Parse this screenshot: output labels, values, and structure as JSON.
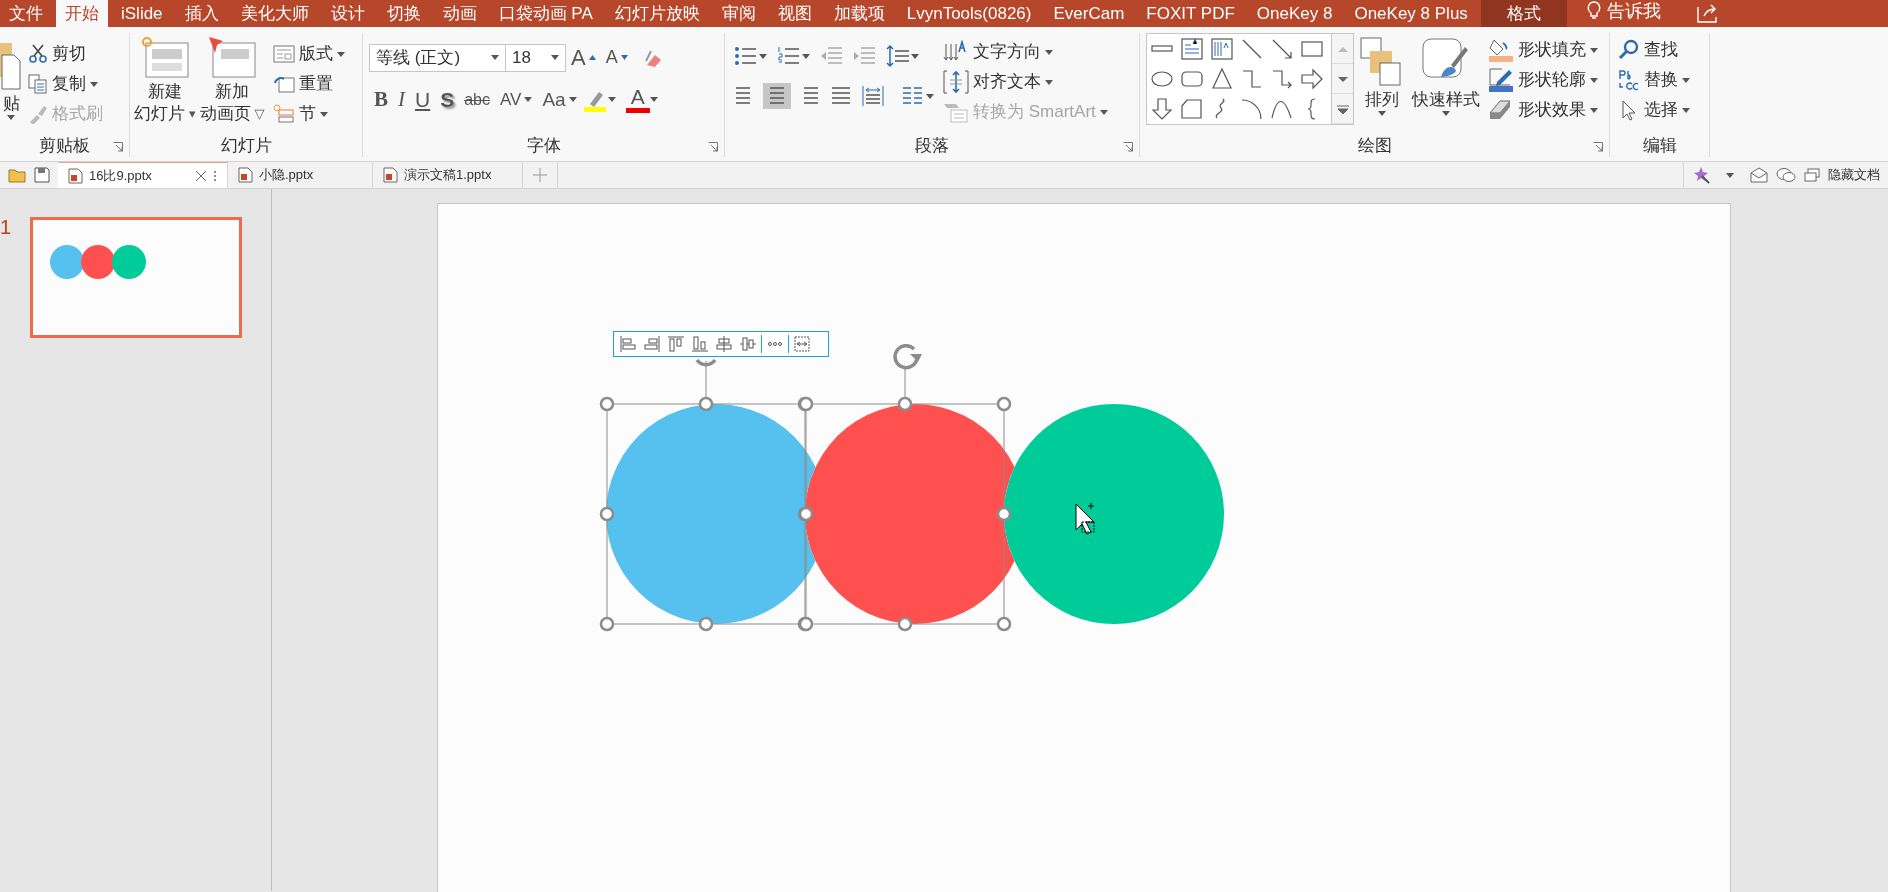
{
  "menu_tabs": [
    {
      "label": "文件",
      "selected": false,
      "contextual": false
    },
    {
      "label": "开始",
      "selected": true,
      "contextual": false
    },
    {
      "label": "iSlide",
      "selected": false,
      "contextual": false
    },
    {
      "label": "插入",
      "selected": false,
      "contextual": false
    },
    {
      "label": "美化大师",
      "selected": false,
      "contextual": false
    },
    {
      "label": "设计",
      "selected": false,
      "contextual": false
    },
    {
      "label": "切换",
      "selected": false,
      "contextual": false
    },
    {
      "label": "动画",
      "selected": false,
      "contextual": false
    },
    {
      "label": "口袋动画 PA",
      "selected": false,
      "contextual": false
    },
    {
      "label": "幻灯片放映",
      "selected": false,
      "contextual": false
    },
    {
      "label": "审阅",
      "selected": false,
      "contextual": false
    },
    {
      "label": "视图",
      "selected": false,
      "contextual": false
    },
    {
      "label": "加载项",
      "selected": false,
      "contextual": false
    },
    {
      "label": "LvynTools(0826)",
      "selected": false,
      "contextual": false
    },
    {
      "label": "EverCam",
      "selected": false,
      "contextual": false
    },
    {
      "label": "FOXIT PDF",
      "selected": false,
      "contextual": false
    },
    {
      "label": "OneKey 8",
      "selected": false,
      "contextual": false
    },
    {
      "label": "OneKey 8 Plus",
      "selected": false,
      "contextual": false
    },
    {
      "label": "格式",
      "selected": false,
      "contextual": true
    }
  ],
  "tell_me": "告诉我",
  "clipboard": {
    "title": "剪贴板",
    "paste": "贴",
    "items": [
      {
        "label": "剪切",
        "disabled": false,
        "dropdown": false
      },
      {
        "label": "复制",
        "disabled": false,
        "dropdown": true
      },
      {
        "label": "格式刷",
        "disabled": true,
        "dropdown": false
      }
    ]
  },
  "slides": {
    "title": "幻灯片",
    "big_buttons": [
      {
        "lines": [
          "新建",
          "幻灯片"
        ],
        "glyph": "▾"
      },
      {
        "lines": [
          "新加",
          "动画页"
        ],
        "glyph": "▽"
      }
    ],
    "small_buttons": [
      {
        "label": "版式",
        "dropdown": true
      },
      {
        "label": "重置",
        "dropdown": false
      },
      {
        "label": "节",
        "dropdown": true
      }
    ]
  },
  "font": {
    "title": "字体",
    "font_name": "等线 (正文)",
    "font_size": "18",
    "size_buttons": [
      {
        "label": "A",
        "kind": "grow"
      },
      {
        "label": "A",
        "kind": "shrink"
      }
    ],
    "format_buttons": [
      {
        "label": "B",
        "kind": "bold"
      },
      {
        "label": "I",
        "kind": "italic"
      },
      {
        "label": "U",
        "kind": "underline"
      },
      {
        "label": "S",
        "kind": "shadow"
      },
      {
        "label": "abc",
        "kind": "strike"
      },
      {
        "label": "AV",
        "kind": "spacing"
      },
      {
        "label": "Aa",
        "kind": "case"
      },
      {
        "label": "A",
        "kind": "color"
      }
    ]
  },
  "paragraph": {
    "title": "段落",
    "align": [
      {
        "selected": false
      },
      {
        "selected": true
      },
      {
        "selected": false
      },
      {
        "selected": false
      },
      {
        "selected": false
      }
    ],
    "commands": [
      {
        "label": "文字方向",
        "disabled": false
      },
      {
        "label": "对齐文本",
        "disabled": false
      },
      {
        "label": "转换为 SmartArt",
        "disabled": true
      }
    ]
  },
  "drawing": {
    "title": "绘图",
    "arrange": "排列",
    "quick_styles": "快速样式",
    "commands": [
      {
        "label": "形状填充"
      },
      {
        "label": "形状轮廓"
      },
      {
        "label": "形状效果"
      }
    ]
  },
  "editing": {
    "title": "编辑",
    "commands": [
      {
        "label": "查找",
        "dropdown": false
      },
      {
        "label": "替换",
        "dropdown": true
      },
      {
        "label": "选择",
        "dropdown": true
      }
    ]
  },
  "doc_tabs": [
    {
      "name": "16比9.pptx",
      "selected": true
    },
    {
      "name": "小隐.pptx",
      "selected": false
    },
    {
      "name": "演示文稿1.pptx",
      "selected": false
    }
  ],
  "hide_docs": "隐藏文档",
  "thumbnails": [
    {
      "number": "1",
      "selected": true
    }
  ],
  "slide": {
    "shapes": [
      {
        "color": "#56c1ee",
        "selected": true
      },
      {
        "color": "#ff5050",
        "selected": true
      },
      {
        "color": "#00cc99",
        "selected": false
      }
    ]
  }
}
